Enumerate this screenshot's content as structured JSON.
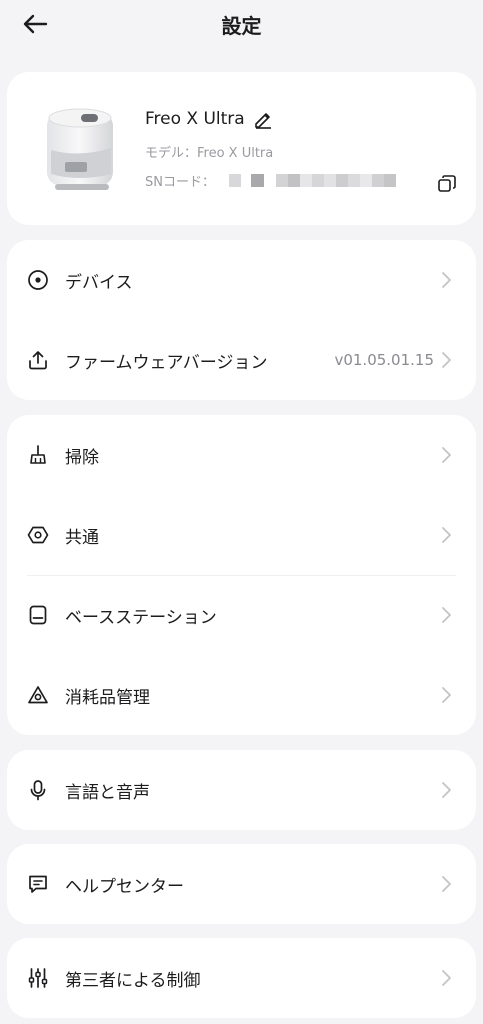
{
  "header": {
    "title": "設定",
    "back_icon": "arrow-left-icon"
  },
  "device": {
    "name": "Freo X Ultra",
    "model_line": "モデル：Freo X Ultra",
    "sn_label": "SNコード："
  },
  "groups": {
    "device_group": [
      {
        "label": "デバイス",
        "value": "",
        "icon": "target-icon"
      },
      {
        "label": "ファームウェアバージョン",
        "value": "v01.05.01.15",
        "icon": "upload-icon"
      }
    ],
    "cleaning_group": [
      {
        "label": "掃除",
        "icon": "broom-icon"
      },
      {
        "label": "共通",
        "icon": "hexagon-icon"
      },
      {
        "label": "ベースステーション",
        "icon": "base-station-icon"
      },
      {
        "label": "消耗品管理",
        "icon": "triangle-icon"
      }
    ],
    "language_group": [
      {
        "label": "言語と音声",
        "icon": "microphone-icon"
      }
    ],
    "help_group": [
      {
        "label": "ヘルプセンター",
        "icon": "chat-icon"
      }
    ],
    "third_party_group": [
      {
        "label": "第三者による制御",
        "icon": "sliders-icon"
      }
    ]
  },
  "colors": {
    "background": "#f4f4f6",
    "card": "#ffffff",
    "text": "#1c1c1e",
    "secondary_text": "#9a9aa0",
    "chevron": "#c4c4c8"
  }
}
